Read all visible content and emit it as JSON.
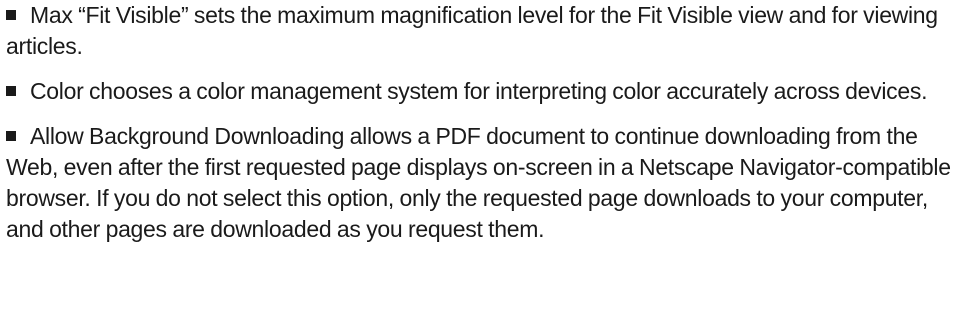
{
  "items": [
    {
      "text": "Max “Fit Visible” sets the maximum magnification level for the Fit Visible view and for viewing articles."
    },
    {
      "text": "Color chooses a color management system for interpreting color accurately across devices."
    },
    {
      "text": "Allow Background Downloading allows a PDF document to continue downloading from the Web, even after the first requested page displays on-screen in a Netscape Navigator-compatible browser. If you do not select this option, only the requested page downloads to your computer, and other pages are downloaded as you request them."
    }
  ]
}
